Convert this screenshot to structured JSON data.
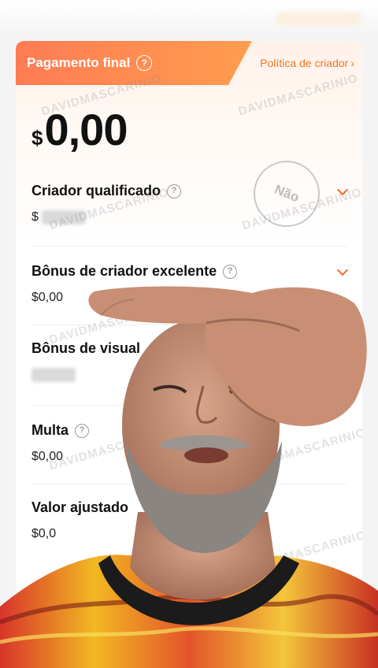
{
  "header": {
    "title": "Pagamento final",
    "policy_link": "Política de criador",
    "policy_chevron": "›"
  },
  "payment": {
    "currency": "$",
    "amount": "0,00"
  },
  "stamp": "Não",
  "rows": [
    {
      "label": "Criador qualificado",
      "value": "$"
    },
    {
      "label": "Bônus de criador excelente",
      "value": "$0,00"
    },
    {
      "label": "Bônus de visual",
      "value": ""
    },
    {
      "label": "Multa",
      "value": "$0,00"
    },
    {
      "label": "Valor ajustado",
      "value": "$0,0"
    }
  ],
  "watermark": "DAVIDMASCARINIO",
  "colors": {
    "header_gradient_start": "#ff7c55",
    "header_gradient_end": "#ff9d4e",
    "accent": "#f0761e"
  },
  "icons": {
    "help": "question-circle-icon",
    "expand": "chevron-down-icon"
  }
}
